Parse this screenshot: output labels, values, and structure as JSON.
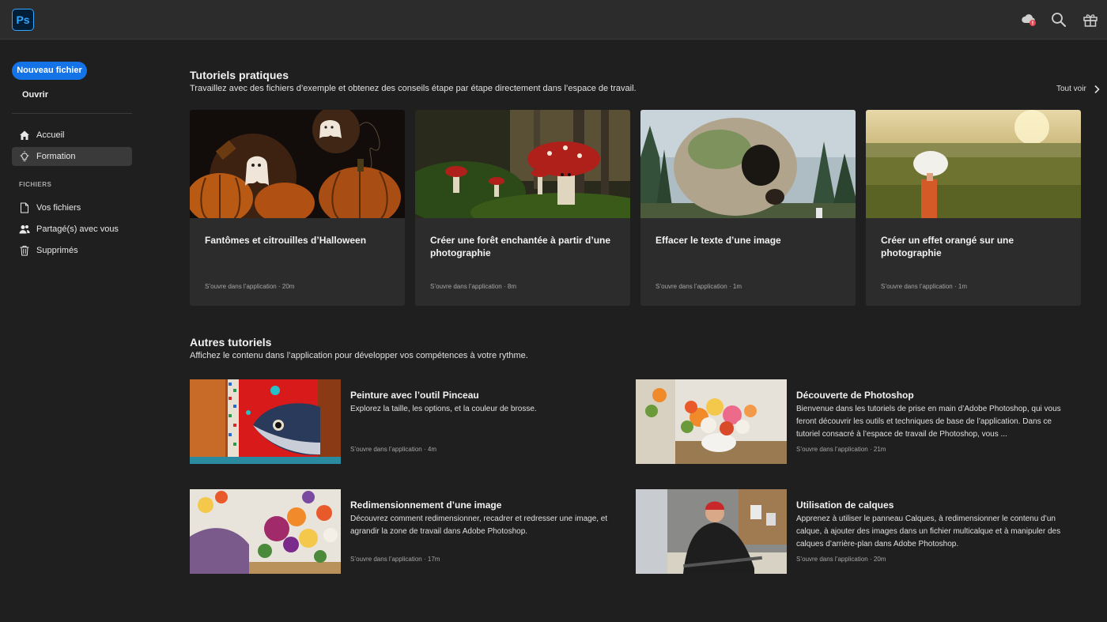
{
  "app": {
    "logo": "Ps"
  },
  "topbar": {
    "icons": [
      "cloud-alert-icon",
      "search-icon",
      "gift-icon"
    ]
  },
  "sidebar": {
    "new_file": "Nouveau fichier",
    "open": "Ouvrir",
    "nav": [
      {
        "label": "Accueil",
        "icon": "home-icon"
      },
      {
        "label": "Formation",
        "icon": "lightbulb-icon",
        "active": true
      }
    ],
    "files_section": "FICHIERS",
    "files": [
      {
        "label": "Vos fichiers",
        "icon": "document-icon"
      },
      {
        "label": "Partagé(s) avec vous",
        "icon": "people-icon"
      },
      {
        "label": "Supprimés",
        "icon": "trash-icon"
      }
    ]
  },
  "practical": {
    "title": "Tutoriels pratiques",
    "subtitle": "Travaillez avec des fichiers d’exemple et obtenez des conseils étape par étape directement dans l’espace de travail.",
    "see_all": "Tout voir",
    "cards": [
      {
        "title": "Fantômes et citrouilles d’Halloween",
        "opens": "S’ouvre dans l’application",
        "sep": "·",
        "duration": "20m"
      },
      {
        "title": "Créer une forêt enchantée à partir d’une photographie",
        "opens": "S’ouvre dans l’application",
        "sep": "·",
        "duration": "8m"
      },
      {
        "title": "Effacer le texte d’une image",
        "opens": "S’ouvre dans l’application",
        "sep": "·",
        "duration": "1m"
      },
      {
        "title": "Créer un effet orangé sur une photographie",
        "opens": "S’ouvre dans l’application",
        "sep": "·",
        "duration": "1m"
      }
    ]
  },
  "others": {
    "title": "Autres tutoriels",
    "subtitle": "Affichez le contenu dans l’application pour développer vos compétences à votre rythme.",
    "items": [
      {
        "title": "Peinture avec l’outil Pinceau",
        "desc": "Explorez la taille, les options, et la couleur de brosse.",
        "opens": "S’ouvre dans l’application",
        "sep": "·",
        "duration": "4m"
      },
      {
        "title": "Découverte de Photoshop",
        "desc": "Bienvenue dans les tutoriels de prise en main d’Adobe Photoshop, qui vous feront découvrir les outils et techniques de base de l’application. Dans ce tutoriel consacré à l’espace de travail de Photoshop, vous ...",
        "opens": "S’ouvre dans l’application",
        "sep": "·",
        "duration": "21m"
      },
      {
        "title": "Redimensionnement d’une image",
        "desc": "Découvrez comment redimensionner, recadrer et redresser une image, et agrandir la zone de travail dans Adobe Photoshop.",
        "opens": "S’ouvre dans l’application",
        "sep": "·",
        "duration": "17m"
      },
      {
        "title": "Utilisation de calques",
        "desc": "Apprenez à utiliser le panneau Calques, à redimensionner le contenu d’un calque, à ajouter des images dans un fichier multicalque et à manipuler des calques d’arrière-plan dans Adobe Photoshop.",
        "opens": "S’ouvre dans l’application",
        "sep": "·",
        "duration": "20m"
      }
    ]
  },
  "colors": {
    "accent": "#1473e6",
    "bg": "#1f1f1f",
    "card": "#2c2c2c",
    "ps_blue": "#31a8ff"
  }
}
